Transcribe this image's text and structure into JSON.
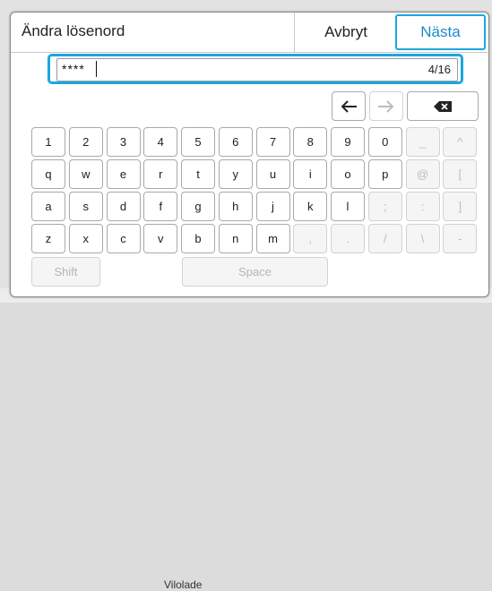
{
  "dialog": {
    "title": "Ändra lösenord",
    "cancel_label": "Avbryt",
    "next_label": "Nästa"
  },
  "password_field": {
    "value": "****",
    "counter": "4/16"
  },
  "keyboard": {
    "row1": [
      "1",
      "2",
      "3",
      "4",
      "5",
      "6",
      "7",
      "8",
      "9",
      "0",
      "_",
      "^"
    ],
    "row2": [
      "q",
      "w",
      "e",
      "r",
      "t",
      "y",
      "u",
      "i",
      "o",
      "p",
      "@",
      "["
    ],
    "row3": [
      "a",
      "s",
      "d",
      "f",
      "g",
      "h",
      "j",
      "k",
      "l",
      ";",
      ":",
      "]"
    ],
    "row4": [
      "z",
      "x",
      "c",
      "v",
      "b",
      "n",
      "m",
      ",",
      ".",
      "/",
      "\\",
      "-"
    ],
    "disabled_count": {
      "row1": 2,
      "row2": 2,
      "row3": 3,
      "row4": 5
    },
    "shift_label": "Shift",
    "space_label": "Space"
  },
  "background": {
    "status_text": "Vilolade"
  },
  "colors": {
    "accent": "#1ba7e0",
    "text": "#222222",
    "disabled_text": "#bcbcbc"
  }
}
